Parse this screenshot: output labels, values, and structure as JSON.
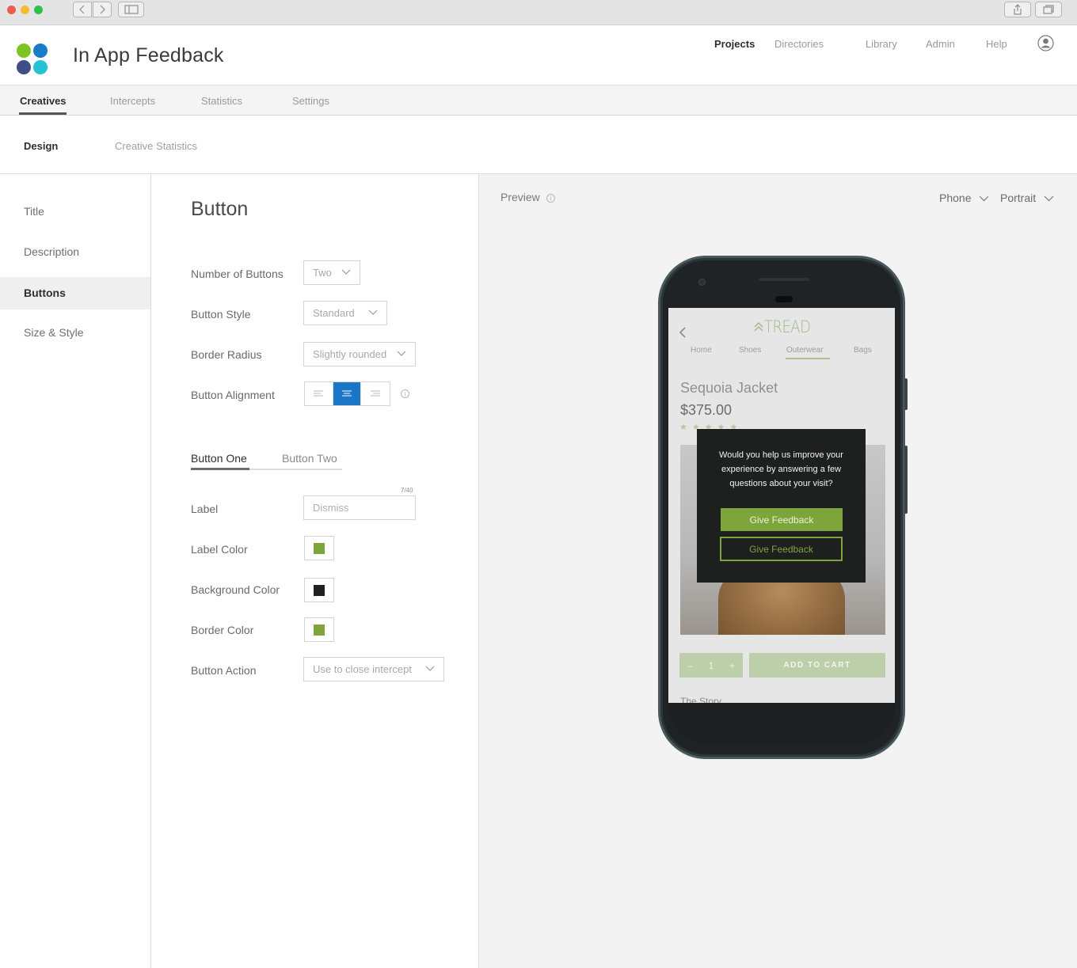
{
  "app": {
    "title": "In App Feedback",
    "logo_colors": [
      "#7fc425",
      "#1a7bc9",
      "#3d4f86",
      "#25c1d4"
    ]
  },
  "topnav": {
    "projects": "Projects",
    "directories": "Directories",
    "library": "Library",
    "admin": "Admin",
    "help": "Help"
  },
  "tabs": {
    "creatives": "Creatives",
    "intercepts": "Intercepts",
    "statistics": "Statistics",
    "settings": "Settings"
  },
  "subtabs": {
    "design": "Design",
    "creative_statistics": "Creative Statistics"
  },
  "sidebar": {
    "items": [
      {
        "label": "Title"
      },
      {
        "label": "Description"
      },
      {
        "label": "Buttons"
      },
      {
        "label": "Size & Style"
      }
    ]
  },
  "form": {
    "title": "Button",
    "number_of_buttons": {
      "label": "Number of Buttons",
      "value": "Two"
    },
    "button_style": {
      "label": "Button Style",
      "value": "Standard"
    },
    "border_radius": {
      "label": "Border Radius",
      "value": "Slightly rounded"
    },
    "button_alignment": {
      "label": "Button Alignment",
      "selected": "center"
    },
    "tabs": {
      "one": "Button One",
      "two": "Button Two"
    },
    "label_field": {
      "label": "Label",
      "placeholder": "Dismiss",
      "counter": "7/40"
    },
    "label_color": {
      "label": "Label Color",
      "color": "#7ea53c"
    },
    "background_color": {
      "label": "Background Color",
      "color": "#1e1f1f"
    },
    "border_color": {
      "label": "Border Color",
      "color": "#7ea53c"
    },
    "button_action": {
      "label": "Button Action",
      "value": "Use to close intercept"
    }
  },
  "preview": {
    "label": "Preview",
    "device": "Phone",
    "orientation": "Portrait",
    "site": {
      "brand": "TREAD",
      "nav": [
        "Home",
        "Shoes",
        "Outerwear",
        "Bags"
      ],
      "active_nav": "Outerwear",
      "product_name": "Sequoia Jacket",
      "product_price": "$375.00",
      "stars": "★★★★★",
      "qty_minus": "–",
      "qty_value": "1",
      "qty_plus": "+",
      "add_to_cart": "ADD TO CART",
      "story_peek": "The Story"
    },
    "intercept": {
      "message": "Would you help us improve your experience by answering a few questions about your visit?",
      "button_one": "Give Feedback",
      "button_two": "Give Feedback"
    }
  }
}
